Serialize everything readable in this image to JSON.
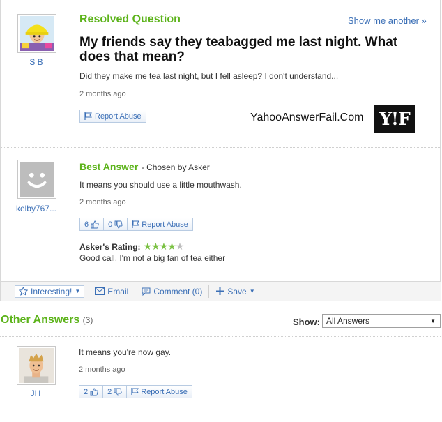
{
  "question": {
    "status": "Resolved Question",
    "show_another": "Show me another »",
    "title": "My friends say they teabagged me last night. What does that mean?",
    "body": "Did they make me tea last night, but I fell asleep? I don't understand...",
    "time": "2 months ago",
    "report": "Report Abuse",
    "asker_name": "S B"
  },
  "watermark": {
    "site": "YahooAnswerFail.Com",
    "logo": "Y!F"
  },
  "best_answer": {
    "label": "Best Answer",
    "chosen_by": "- Chosen by Asker",
    "body": "It means you should use a little mouthwash.",
    "time": "2 months ago",
    "thumbs_up": "6",
    "thumbs_down": "0",
    "report": "Report Abuse",
    "user_name": "kelby767...",
    "rating_label": "Asker's Rating:",
    "rating_value": 4,
    "rating_max": 5,
    "rating_comment": "Good call, I'm not a big fan of tea either"
  },
  "toolbar": {
    "interesting": "Interesting!",
    "email": "Email",
    "comment": "Comment (0)",
    "save": "Save"
  },
  "other_answers": {
    "title": "Other Answers",
    "count": "(3)",
    "show_label": "Show:",
    "show_value": "All Answers",
    "items": [
      {
        "body": "It means you're now gay.",
        "time": "2 months ago",
        "thumbs_up": "2",
        "thumbs_down": "2",
        "report": "Report Abuse",
        "user_name": "JH"
      }
    ]
  },
  "colors": {
    "accent_green": "#5cb31a",
    "link_blue": "#3b6fb6"
  }
}
